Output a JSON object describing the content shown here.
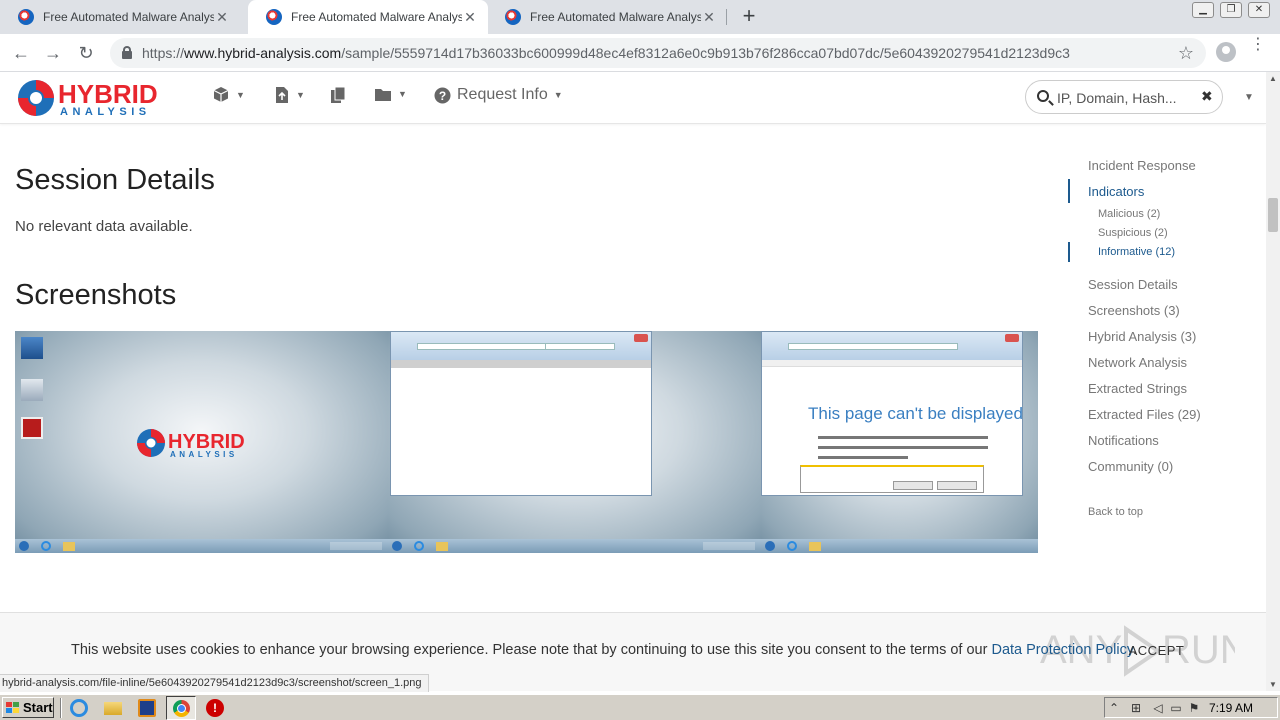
{
  "browser": {
    "tabs": [
      {
        "title": "Free Automated Malware Analysis S",
        "active": false
      },
      {
        "title": "Free Automated Malware Analysis S",
        "active": true
      },
      {
        "title": "Free Automated Malware Analysis S",
        "active": false
      }
    ],
    "url_scheme": "https://",
    "url_host": "www.hybrid-analysis.com",
    "url_path": "/sample/5559714d17b36033bc600999d48ec4ef8312a6e0c9b913b76f286cca07bd07dc/5e6043920279541d2123d9c3",
    "status_url": "hybrid-analysis.com/file-inline/5e6043920279541d2123d9c3/screenshot/screen_1.png"
  },
  "site": {
    "logo_line1": "HYBRID",
    "logo_line2": "ANALYSIS",
    "nav": {
      "request_info": "Request Info"
    },
    "search": {
      "placeholder": "IP, Domain, Hash..."
    }
  },
  "content": {
    "session_title": "Session Details",
    "session_text": "No relevant data available.",
    "screenshots_title": "Screenshots",
    "screenshot3_heading": "This page can't be displayed"
  },
  "sidebar": {
    "items": [
      {
        "label": "Incident Response",
        "active": false
      },
      {
        "label": "Indicators",
        "active": true
      }
    ],
    "sub_items": [
      {
        "label": "Malicious (2)",
        "active": false
      },
      {
        "label": "Suspicious (2)",
        "active": false
      },
      {
        "label": "Informative (12)",
        "active": true
      }
    ],
    "items2": [
      {
        "label": "Session Details"
      },
      {
        "label": "Screenshots (3)"
      },
      {
        "label": "Hybrid Analysis (3)"
      },
      {
        "label": "Network Analysis"
      },
      {
        "label": "Extracted Strings"
      },
      {
        "label": "Extracted Files (29)"
      },
      {
        "label": "Notifications"
      },
      {
        "label": "Community (0)"
      }
    ],
    "back_to_top": "Back to top"
  },
  "cookie": {
    "text": "This website uses cookies to enhance your browsing experience. Please note that by continuing to use this site you consent to the terms of our ",
    "link": "Data Protection Policy",
    "period": ".",
    "accept": "ACCEPT"
  },
  "taskbar": {
    "start": "Start",
    "clock": "7:19 AM"
  },
  "colors": {
    "brand_red": "#e8262e",
    "brand_blue": "#1f6fb8",
    "link_blue": "#1d5a8e"
  }
}
